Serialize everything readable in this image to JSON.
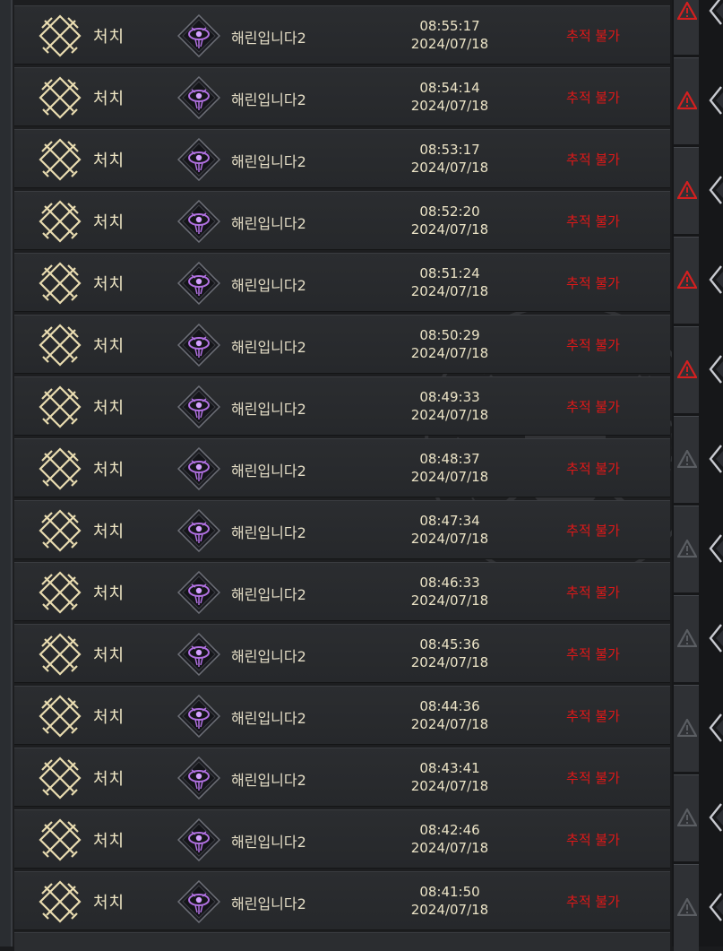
{
  "rows": [
    {
      "type": "처치",
      "player": "해린입니다2",
      "time": "08:55:17",
      "date": "2024/07/18",
      "status": "추적 불가"
    },
    {
      "type": "처치",
      "player": "해린입니다2",
      "time": "08:54:14",
      "date": "2024/07/18",
      "status": "추적 불가"
    },
    {
      "type": "처치",
      "player": "해린입니다2",
      "time": "08:53:17",
      "date": "2024/07/18",
      "status": "추적 불가"
    },
    {
      "type": "처치",
      "player": "해린입니다2",
      "time": "08:52:20",
      "date": "2024/07/18",
      "status": "추적 불가"
    },
    {
      "type": "처치",
      "player": "해린입니다2",
      "time": "08:51:24",
      "date": "2024/07/18",
      "status": "추적 불가"
    },
    {
      "type": "처치",
      "player": "해린입니다2",
      "time": "08:50:29",
      "date": "2024/07/18",
      "status": "추적 불가"
    },
    {
      "type": "처치",
      "player": "해린입니다2",
      "time": "08:49:33",
      "date": "2024/07/18",
      "status": "추적 불가"
    },
    {
      "type": "처치",
      "player": "해린입니다2",
      "time": "08:48:37",
      "date": "2024/07/18",
      "status": "추적 불가"
    },
    {
      "type": "처치",
      "player": "해린입니다2",
      "time": "08:47:34",
      "date": "2024/07/18",
      "status": "추적 불가"
    },
    {
      "type": "처치",
      "player": "해린입니다2",
      "time": "08:46:33",
      "date": "2024/07/18",
      "status": "추적 불가"
    },
    {
      "type": "처치",
      "player": "해린입니다2",
      "time": "08:45:36",
      "date": "2024/07/18",
      "status": "추적 불가"
    },
    {
      "type": "처치",
      "player": "해린입니다2",
      "time": "08:44:36",
      "date": "2024/07/18",
      "status": "추적 불가"
    },
    {
      "type": "처치",
      "player": "해린입니다2",
      "time": "08:43:41",
      "date": "2024/07/18",
      "status": "추적 불가"
    },
    {
      "type": "처치",
      "player": "해린입니다2",
      "time": "08:42:46",
      "date": "2024/07/18",
      "status": "추적 불가"
    },
    {
      "type": "처치",
      "player": "해린입니다2",
      "time": "08:41:50",
      "date": "2024/07/18",
      "status": "추적 불가"
    }
  ],
  "icons": {
    "row_type_icon": "crossed-swords-icon",
    "class_icon": "purple-eye-emblem-icon",
    "side_warning_icon": "warning-triangle-icon",
    "side_arrow_icon": "chevron-left-icon"
  },
  "side_panel": {
    "cells": [
      {
        "warning_color": "#d42020"
      },
      {
        "warning_color": "#d42020"
      },
      {
        "warning_color": "#d42020"
      },
      {
        "warning_color": "#d42020"
      },
      {
        "warning_color": "#d42020"
      },
      {
        "warning_color": "#5a5d62"
      },
      {
        "warning_color": "#5a5d62"
      },
      {
        "warning_color": "#5a5d62"
      },
      {
        "warning_color": "#5a5d62"
      },
      {
        "warning_color": "#5a5d62"
      },
      {
        "warning_color": "#5a5d62"
      }
    ]
  },
  "colors": {
    "status_red": "#e01818",
    "text_cream": "#efe6c4",
    "class_purple": "#b070e0",
    "row_bg": "#2b2d30"
  }
}
